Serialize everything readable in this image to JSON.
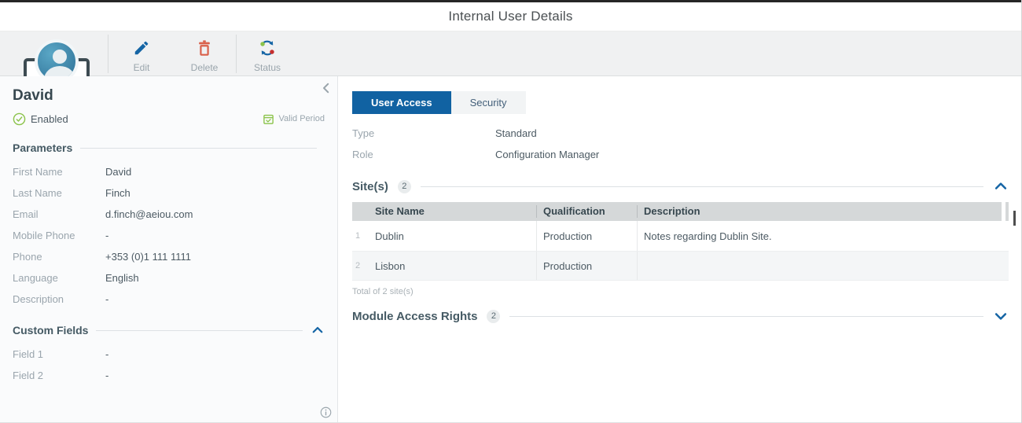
{
  "window": {
    "title": "Internal User Details"
  },
  "toolbar": {
    "edit_label": "Edit",
    "delete_label": "Delete",
    "status_label": "Status"
  },
  "user_summary": {
    "name": "David",
    "status": "Enabled",
    "valid_period_label": "Valid Period"
  },
  "parameters": {
    "heading": "Parameters",
    "items": [
      {
        "label": "First Name",
        "value": "David"
      },
      {
        "label": "Last Name",
        "value": "Finch"
      },
      {
        "label": "Email",
        "value": "d.finch@aeiou.com"
      },
      {
        "label": "Mobile Phone",
        "value": "-"
      },
      {
        "label": "Phone",
        "value": "+353 (0)1 111 1111"
      },
      {
        "label": "Language",
        "value": "English"
      },
      {
        "label": "Description",
        "value": "-"
      }
    ]
  },
  "custom_fields": {
    "heading": "Custom Fields",
    "items": [
      {
        "label": "Field 1",
        "value": "-"
      },
      {
        "label": "Field 2",
        "value": "-"
      }
    ]
  },
  "tabs": [
    {
      "label": "User Access"
    },
    {
      "label": "Security"
    }
  ],
  "access_details": [
    {
      "label": "Type",
      "value": "Standard"
    },
    {
      "label": "Role",
      "value": "Configuration Manager"
    }
  ],
  "sites": {
    "heading": "Site(s)",
    "count": "2",
    "columns": [
      "Site Name",
      "Qualification",
      "Description"
    ],
    "rows": [
      {
        "num": "1",
        "site_name": "Dublin",
        "qualification": "Production",
        "description": "Notes regarding Dublin Site."
      },
      {
        "num": "2",
        "site_name": "Lisbon",
        "qualification": "Production",
        "description": ""
      }
    ],
    "total": "Total of 2 site(s)"
  },
  "module_access": {
    "heading": "Module Access Rights",
    "count": "2"
  },
  "colors": {
    "accent_blue": "#1162a2",
    "success_green": "#8bc34a",
    "delete_red": "#d9604a",
    "chrome_dark": "#262626"
  }
}
